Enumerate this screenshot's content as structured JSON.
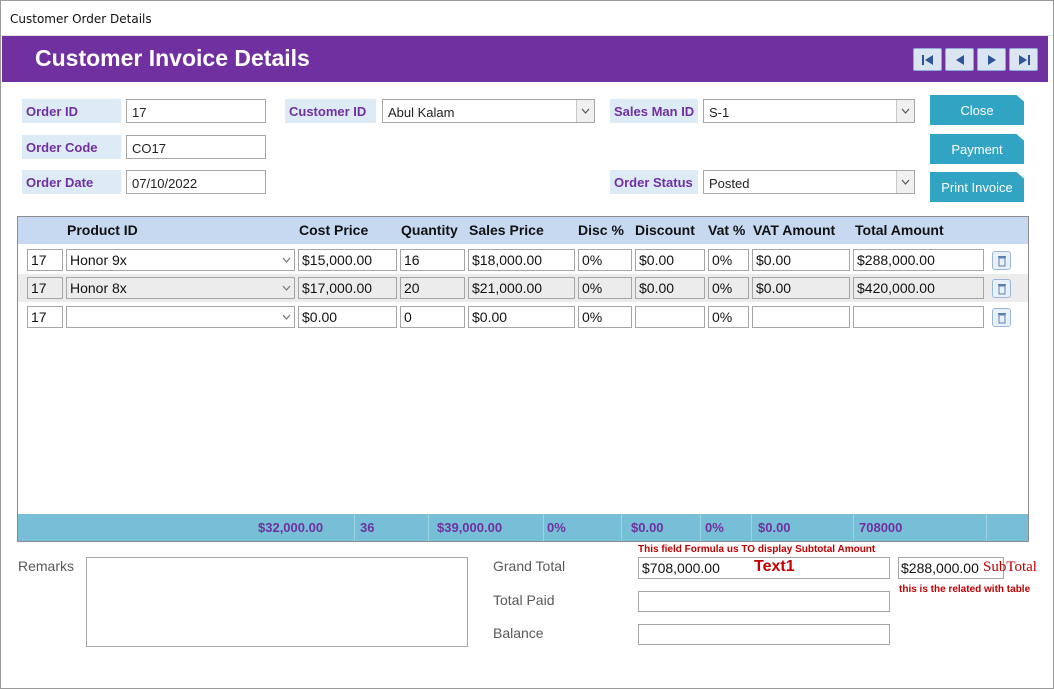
{
  "window": {
    "title": "Customer Order Details"
  },
  "header": {
    "title": "Customer Invoice Details"
  },
  "nav": [
    "first-record-icon",
    "previous-record-icon",
    "next-record-icon",
    "last-record-icon"
  ],
  "form": {
    "order_id": {
      "label": "Order ID",
      "value": "17"
    },
    "order_code": {
      "label": "Order Code",
      "value": "CO17"
    },
    "order_date": {
      "label": "Order Date",
      "value": "07/10/2022"
    },
    "customer_id": {
      "label": "Customer ID",
      "value": "Abul Kalam"
    },
    "sales_man_id": {
      "label": "Sales Man ID",
      "value": "S-1"
    },
    "order_status": {
      "label": "Order Status",
      "value": "Posted"
    }
  },
  "buttons": {
    "close": "Close",
    "payment": "Payment",
    "print_invoice": "Print Invoice"
  },
  "grid": {
    "headers": {
      "product_id": "Product ID",
      "cost_price": "Cost Price",
      "quantity": "Quantity",
      "sales_price": "Sales Price",
      "disc_pct": "Disc %",
      "discount": "Discount",
      "vat_pct": "Vat %",
      "vat_amount": "VAT Amount",
      "total_amount": "Total Amount"
    },
    "rows": [
      {
        "order": "17",
        "product": "Honor 9x",
        "cost": "$15,000.00",
        "qty": "16",
        "sales": "$18,000.00",
        "disc_pct": "0%",
        "discount": "$0.00",
        "vat_pct": "0%",
        "vat_amount": "$0.00",
        "total": "$288,000.00"
      },
      {
        "order": "17",
        "product": "Honor 8x",
        "cost": "$17,000.00",
        "qty": "20",
        "sales": "$21,000.00",
        "disc_pct": "0%",
        "discount": "$0.00",
        "vat_pct": "0%",
        "vat_amount": "$0.00",
        "total": "$420,000.00"
      },
      {
        "order": "17",
        "product": "",
        "cost": "$0.00",
        "qty": "0",
        "sales": "$0.00",
        "disc_pct": "0%",
        "discount": "",
        "vat_pct": "0%",
        "vat_amount": "",
        "total": ""
      }
    ],
    "totals": {
      "cost": "$32,000.00",
      "qty": "36",
      "sales": "$39,000.00",
      "disc_pct": "0%",
      "discount": "$0.00",
      "vat_pct": "0%",
      "vat_amount": "$0.00",
      "total": "708000"
    }
  },
  "footer": {
    "remarks_label": "Remarks",
    "grand_total_label": "Grand Total",
    "grand_total_value": "$708,000.00",
    "grand_total_overlay": "Text1",
    "total_paid_label": "Total Paid",
    "balance_label": "Balance",
    "subtotal_value": "$288,000.00",
    "subtotal_label": "SubTotal",
    "note_formula": "This field Formula us TO display Subtotal Amount",
    "note_related": "this is the related with table"
  },
  "colors": {
    "header": "#7030a0",
    "button": "#31a3c3",
    "grid_header": "#c6d9f1",
    "totals_bar": "#77bfd6",
    "note": "#c00000"
  }
}
